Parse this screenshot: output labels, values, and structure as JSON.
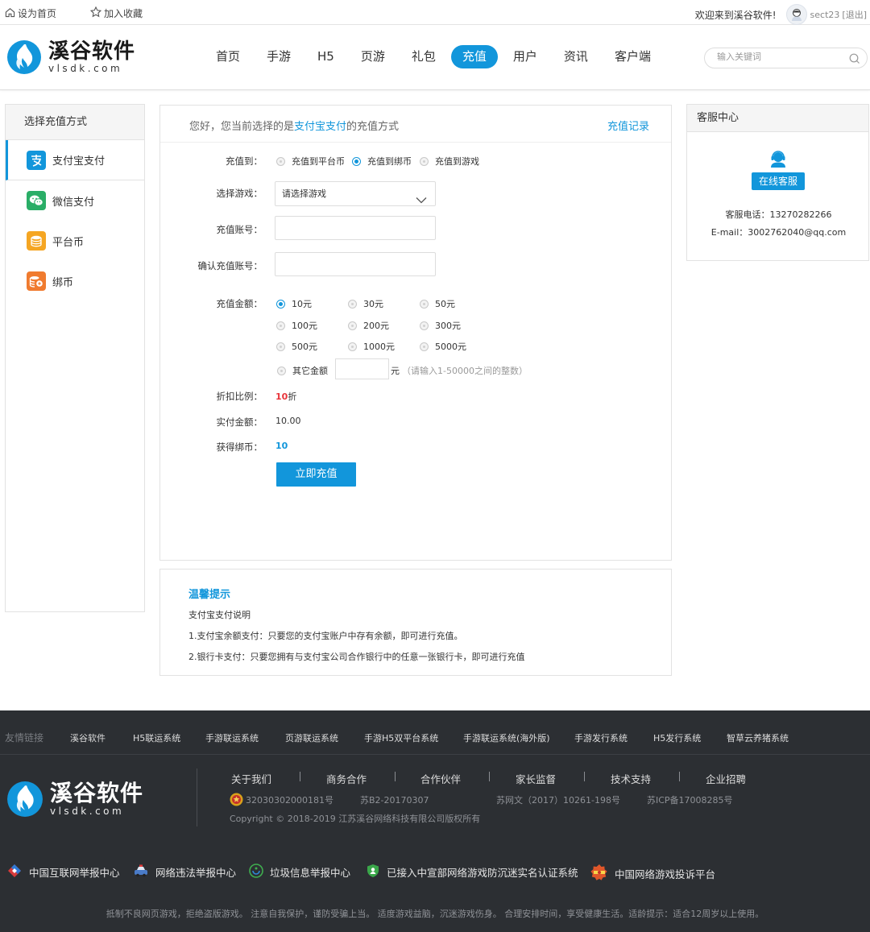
{
  "topbar": {
    "set_home": "设为首页",
    "add_fav": "加入收藏",
    "welcome": "欢迎来到溪谷软件!",
    "username": "sect23",
    "logout": "[退出]"
  },
  "brand": {
    "name_cn": "溪谷软件",
    "name_en": "vlsdk.com"
  },
  "nav": {
    "items": [
      "首页",
      "手游",
      "H5",
      "页游",
      "礼包",
      "充值",
      "用户",
      "资讯",
      "客户端"
    ],
    "active": "充值"
  },
  "search": {
    "placeholder": "输入关键词"
  },
  "sidebar": {
    "title": "选择充值方式",
    "items": [
      {
        "label": "支付宝支付",
        "icon": "alipay-icon",
        "color": "#1296db"
      },
      {
        "label": "微信支付",
        "icon": "wechat-icon",
        "color": "#2aae67"
      },
      {
        "label": "平台币",
        "icon": "coin-stack-icon",
        "color": "#f5a623"
      },
      {
        "label": "绑币",
        "icon": "bound-coin-icon",
        "color": "#f07b2f"
      }
    ]
  },
  "main": {
    "greeting_prefix": "您好，您当前选择的是",
    "method": "支付宝支付",
    "greeting_suffix": "的充值方式",
    "records_link": "充值记录",
    "labels": {
      "target": "充值到：",
      "game": "选择游戏：",
      "account": "充值账号：",
      "confirm_account": "确认充值账号：",
      "amount": "充值金额：",
      "discount": "折扣比例：",
      "actual": "实付金额：",
      "earned": "获得绑币："
    },
    "target_options": [
      {
        "label": "充值到平台币",
        "selected": false
      },
      {
        "label": "充值到绑币",
        "selected": true
      },
      {
        "label": "充值到游戏",
        "selected": false
      }
    ],
    "game_select": "请选择游戏",
    "amounts": [
      "10元",
      "30元",
      "50元",
      "100元",
      "200元",
      "300元",
      "500元",
      "1000元",
      "5000元"
    ],
    "selected_amount": "10元",
    "other_amount": {
      "label": "其它金额",
      "unit": "元",
      "hint": "（请输入1-50000之间的整数）"
    },
    "discount_value": "10",
    "discount_unit": "折",
    "actual_value": "10.00",
    "earned_value": "10",
    "submit": "立即充值"
  },
  "tips": {
    "title": "温馨提示",
    "lines": [
      "支付宝支付说明",
      "1.支付宝余额支付：只要您的支付宝账户中存有余额，即可进行充值。",
      "2.银行卡支付：只要您拥有与支付宝公司合作银行中的任意一张银行卡，即可进行充值"
    ]
  },
  "service": {
    "title": "客服中心",
    "button": "在线客服",
    "phone": "客服电话：13270282266",
    "email": "E-mail：3002762040@qq.com"
  },
  "footer": {
    "links_title": "友情链接",
    "links": [
      "溪谷软件",
      "H5联运系统",
      "手游联运系统",
      "页游联运系统",
      "手游H5双平台系统",
      "手游联运系统(海外版)",
      "手游发行系统",
      "H5发行系统",
      "智草云养猪系统"
    ],
    "nav": [
      "关于我们",
      "商务合作",
      "合作伙伴",
      "家长监督",
      "技术支持",
      "企业招聘"
    ],
    "police": "32030302000181号",
    "icp_b2": "苏B2-20170307",
    "net_culture": "苏网文（2017）10261-198号",
    "icp": "苏ICP备17008285号",
    "copyright": "Copyright © 2018-2019 江苏溪谷网络科技有限公司版权所有",
    "reports": [
      "中国互联网举报中心",
      "网络违法举报中心",
      "垃圾信息举报中心",
      "已接入中宣部网络游戏防沉迷实名认证系统",
      "中国网络游戏投诉平台"
    ],
    "notice": "抵制不良网页游戏，拒绝盗版游戏。 注意自我保护，谨防受骗上当。 适度游戏益脑，沉迷游戏伤身。 合理安排时间，享受健康生活。适龄提示：适合12周岁以上使用。"
  },
  "colors": {
    "accent": "#1296db",
    "discount_red": "#e8343a",
    "footer_bg": "#2c2f33"
  }
}
